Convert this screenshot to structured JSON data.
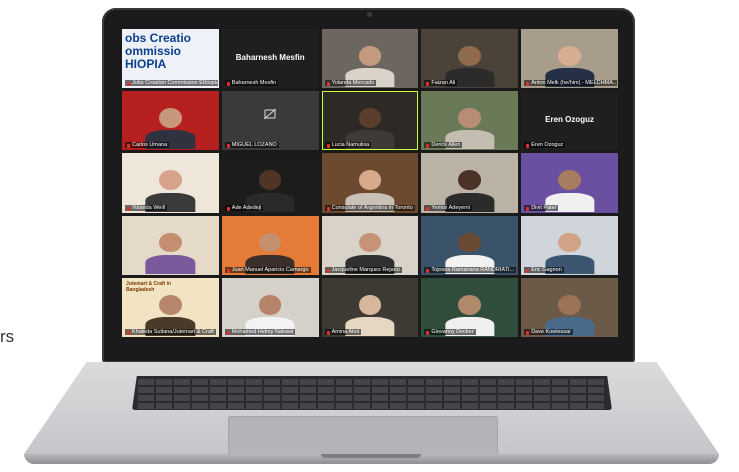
{
  "background_text": "rs",
  "meeting": {
    "participants": [
      {
        "name": "Jobs Creation Commission Ethiopia",
        "banner": "obs Creatio\nommissio\nHIOPIA",
        "bg": "#eef2f8",
        "kind": "banner"
      },
      {
        "name": "Baharnesh Mesfin",
        "big": "Baharnesh Mesfin",
        "bg": "#1f1f1f",
        "kind": "name-only"
      },
      {
        "name": "Yolanda Mercado",
        "bg": "#6d6560",
        "skin": "#c39a7e",
        "shirt": "#d9d2c9",
        "kind": "person"
      },
      {
        "name": "Faizan Ali",
        "bg": "#4b4339",
        "skin": "#8f6a4d",
        "shirt": "#2b2b2b",
        "kind": "person"
      },
      {
        "name": "Anton Melk (he/him) - MELCHMARK",
        "bg": "#a89c8a",
        "skin": "#d7ad90",
        "shirt": "#253047",
        "kind": "person"
      },
      {
        "name": "Carlos Umana",
        "bg": "#b5201e",
        "skin": "#c7977b",
        "shirt": "#2f3340",
        "kind": "person"
      },
      {
        "name": "MIGUEL LOZANO",
        "bg": "#3a3a3a",
        "kind": "muted"
      },
      {
        "name": "Lucia Namulisa",
        "bg": "#2d2a26",
        "skin": "#5a3d2b",
        "shirt": "#3e3a35",
        "kind": "person",
        "active": true
      },
      {
        "name": "Derick Allen",
        "bg": "#6a7a58",
        "skin": "#b98d75",
        "shirt": "#c4bdb2",
        "kind": "person"
      },
      {
        "name": "Eren Ozoguz",
        "big": "Eren Ozoguz",
        "bg": "#1f1f1f",
        "kind": "name-only"
      },
      {
        "name": "Yolanda Weill",
        "bg": "#efe6da",
        "skin": "#d6a48a",
        "shirt": "#3a3a3a",
        "kind": "person"
      },
      {
        "name": "Ade Adedeji",
        "bg": "#1d1c1a",
        "skin": "#4e3526",
        "shirt": "#2a2a2a",
        "kind": "person"
      },
      {
        "name": "Consulate of Argentina in Toronto",
        "bg": "#6b4a2f",
        "skin": "#d8aa8c",
        "shirt": "#c9c0b7",
        "kind": "person"
      },
      {
        "name": "Yemisi Adeyemi",
        "bg": "#b9b2a5",
        "skin": "#4a3224",
        "shirt": "#2b2b2b",
        "kind": "person"
      },
      {
        "name": "Divit Patel",
        "bg": "#6b4fa0",
        "skin": "#a87c5e",
        "shirt": "#f0f0f0",
        "kind": "person"
      },
      {
        "name": "",
        "bg": "#e5d9c8",
        "skin": "#c48f70",
        "shirt": "#7a5a9a",
        "kind": "person"
      },
      {
        "name": "Juan Manuel Aparicio Camargo",
        "bg": "#e47b36",
        "skin": "#c4906f",
        "shirt": "#3a2f2a",
        "kind": "person"
      },
      {
        "name": "Jacqueline Marquez Rejano",
        "bg": "#d8d2c8",
        "skin": "#c79377",
        "shirt": "#303030",
        "kind": "person"
      },
      {
        "name": "Tojosoa Ramanana RANDRIATI...",
        "bg": "#3a5368",
        "skin": "#6a4a34",
        "shirt": "#f2f2f2",
        "kind": "person"
      },
      {
        "name": "Eric Gagnon",
        "bg": "#cfd5da",
        "skin": "#d3a388",
        "shirt": "#3c5570",
        "kind": "person"
      },
      {
        "name": "Khaleda Sultana/Jutemart & Craft",
        "poster": "Jutemart & Craft in Bangladesh",
        "bg": "#f2e3c2",
        "skin": "#b8866a",
        "shirt": "#4a3a2a",
        "kind": "poster"
      },
      {
        "name": "Mohamed Helmy Nabawi",
        "bg": "#d5d0c8",
        "skin": "#b48369",
        "shirt": "#f3f3f3",
        "kind": "person"
      },
      {
        "name": "Amina Akol",
        "bg": "#3c3a33",
        "skin": "#d7b79b",
        "shirt": "#e6d7c2",
        "kind": "person"
      },
      {
        "name": "Giovanny Decker",
        "bg": "#2f4d3a",
        "skin": "#b1886a",
        "shirt": "#f0f0f0",
        "kind": "person"
      },
      {
        "name": "Dave Kowlessar",
        "bg": "#6c5a48",
        "skin": "#9d7357",
        "shirt": "#4a6a8a",
        "kind": "person"
      }
    ]
  }
}
